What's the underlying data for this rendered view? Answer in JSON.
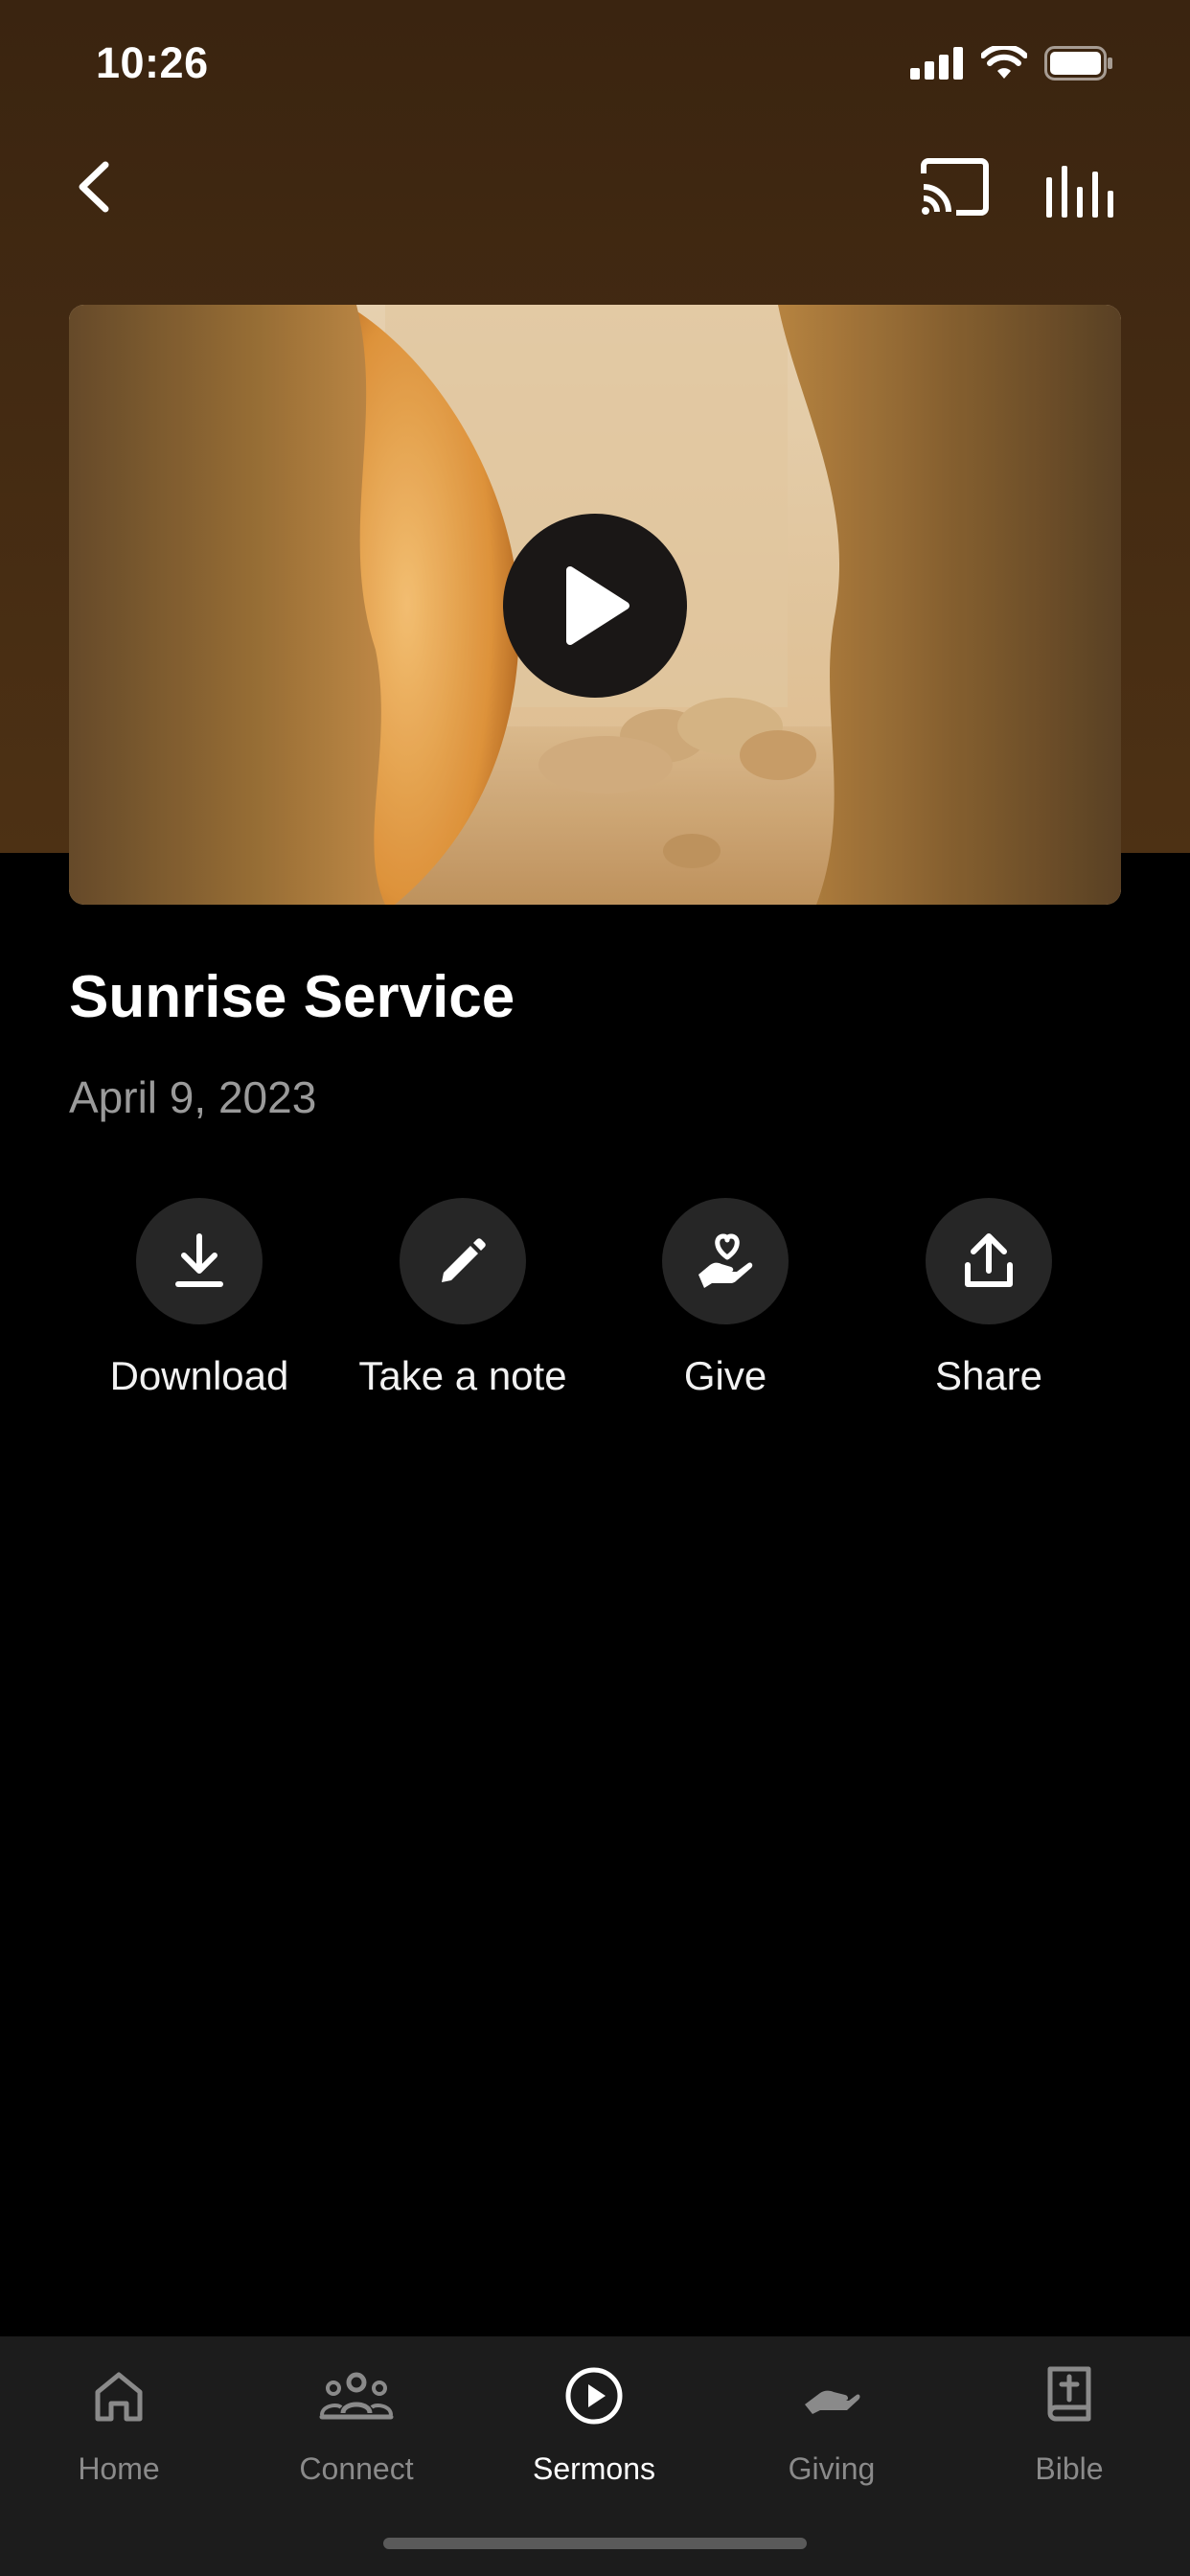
{
  "status_bar": {
    "time": "10:26"
  },
  "header": {
    "back_icon": "chevron-left-icon",
    "cast_icon": "cast-icon",
    "audio_icon": "equalizer-icon"
  },
  "video": {
    "play_icon": "play-icon"
  },
  "sermon": {
    "title": "Sunrise Service",
    "date": "April 9, 2023"
  },
  "actions": [
    {
      "label": "Download",
      "icon": "download-icon"
    },
    {
      "label": "Take a note",
      "icon": "pencil-icon"
    },
    {
      "label": "Give",
      "icon": "hand-heart-icon"
    },
    {
      "label": "Share",
      "icon": "share-icon"
    }
  ],
  "tabs": [
    {
      "label": "Home",
      "icon": "home-icon",
      "active": false
    },
    {
      "label": "Connect",
      "icon": "people-icon",
      "active": false
    },
    {
      "label": "Sermons",
      "icon": "play-circle-icon",
      "active": true
    },
    {
      "label": "Giving",
      "icon": "giving-hand-icon",
      "active": false
    },
    {
      "label": "Bible",
      "icon": "bible-icon",
      "active": false
    }
  ],
  "colors": {
    "hero_brown": "#432a12",
    "background": "#000000",
    "tab_bar": "#1c1c1c",
    "action_circle": "#262626",
    "muted_text": "#9a9a9a"
  }
}
